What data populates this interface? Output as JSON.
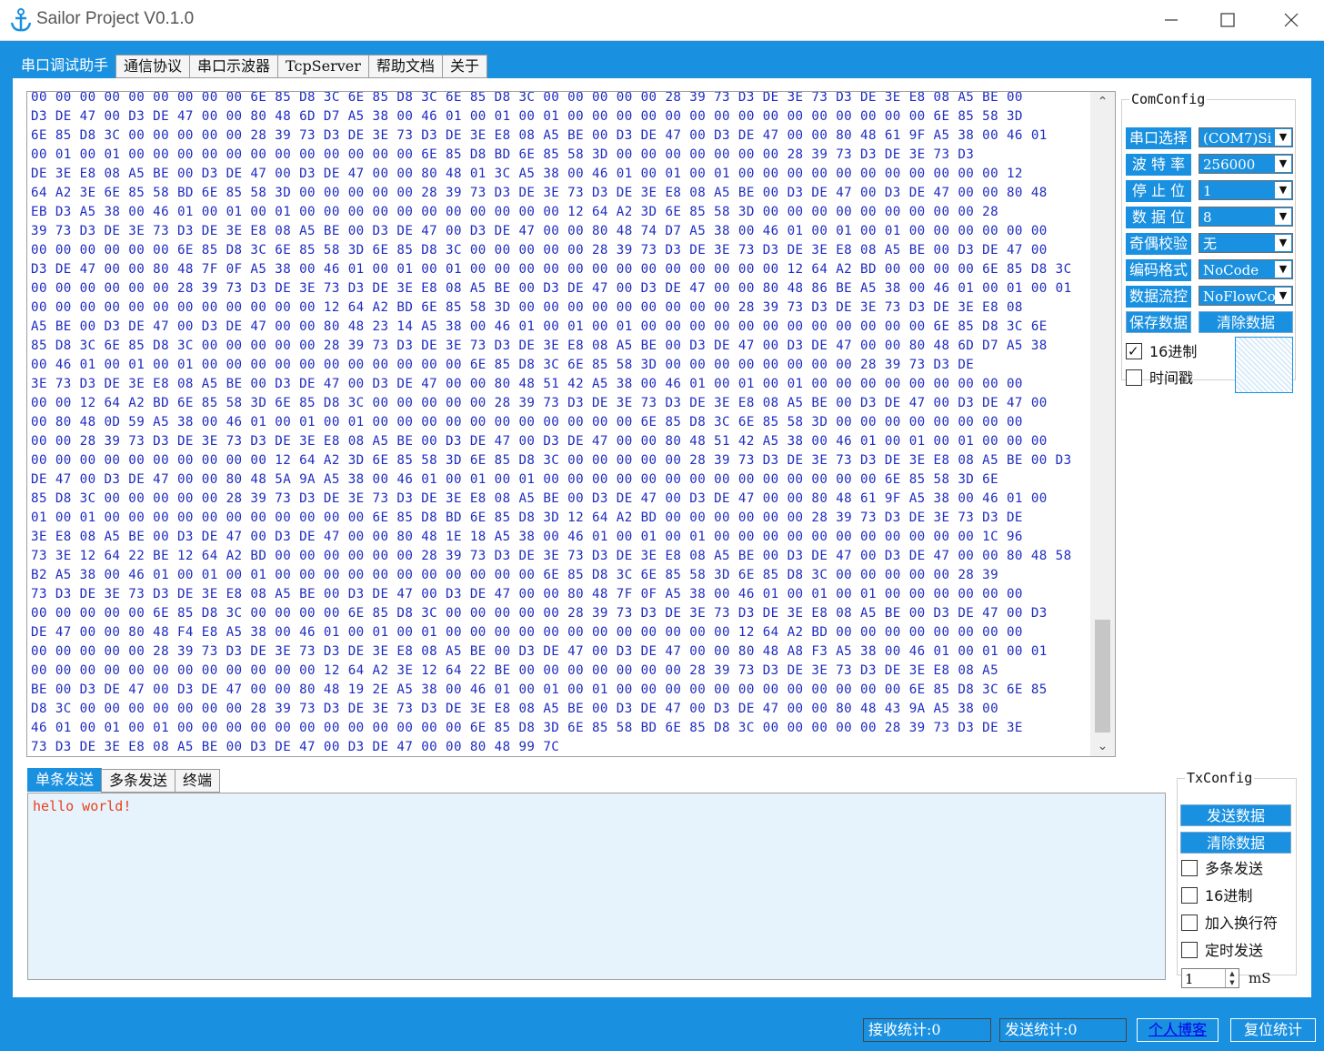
{
  "window": {
    "title": "Sailor Project V0.1.0",
    "accent_color": "#1a90e0",
    "icons": [
      "anchor-icon",
      "minimize-icon",
      "maximize-icon",
      "close-icon"
    ]
  },
  "tabs": [
    {
      "label": "串口调试助手",
      "active": true
    },
    {
      "label": "通信协议",
      "active": false
    },
    {
      "label": "串口示波器",
      "active": false
    },
    {
      "label": "TcpServer",
      "active": false
    },
    {
      "label": "帮助文档",
      "active": false
    },
    {
      "label": "关于",
      "active": false
    }
  ],
  "receive": {
    "lines": [
      "00 00 00 00 00 00 00 00 00 6E 85 D8 3C 6E 85 D8 3C 6E 85 D8 3C 00 00 00 00 00 28 39 73 D3 DE 3E 73 D3 DE 3E E8 08 A5 BE 00",
      "D3 DE 47 00 D3 DE 47 00 00 80 48 6D D7 A5 38 00 46 01 00 01 00 01 00 00 00 00 00 00 00 00 00 00 00 00 00 00 00 6E 85 58 3D",
      "6E 85 D8 3C 00 00 00 00 00 28 39 73 D3 DE 3E 73 D3 DE 3E E8 08 A5 BE 00 D3 DE 47 00 D3 DE 47 00 00 80 48 61 9F A5 38 00 46 01",
      "00 01 00 01 00 00 00 00 00 00 00 00 00 00 00 00 6E 85 D8 BD 6E 85 58 3D 00 00 00 00 00 00 00 28 39 73 D3 DE 3E 73 D3",
      "DE 3E E8 08 A5 BE 00 D3 DE 47 00 D3 DE 47 00 00 80 48 01 3C A5 38 00 46 01 00 01 00 01 00 00 00 00 00 00 00 00 00 00 00 12",
      "64 A2 3E 6E 85 58 BD 6E 85 58 3D 00 00 00 00 00 28 39 73 D3 DE 3E 73 D3 DE 3E E8 08 A5 BE 00 D3 DE 47 00 D3 DE 47 00 00 80 48",
      "EB D3 A5 38 00 46 01 00 01 00 01 00 00 00 00 00 00 00 00 00 00 00 12 64 A2 3D 6E 85 58 3D 00 00 00 00 00 00 00 00 00 28",
      "39 73 D3 DE 3E 73 D3 DE 3E E8 08 A5 BE 00 D3 DE 47 00 D3 DE 47 00 00 80 48 74 D7 A5 38 00 46 01 00 01 00 01 00 00 00 00 00 00",
      "00 00 00 00 00 00 6E 85 D8 3C 6E 85 58 3D 6E 85 D8 3C 00 00 00 00 00 28 39 73 D3 DE 3E 73 D3 DE 3E E8 08 A5 BE 00 D3 DE 47 00",
      "D3 DE 47 00 00 80 48 7F 0F A5 38 00 46 01 00 01 00 01 00 00 00 00 00 00 00 00 00 00 00 00 00 12 64 A2 BD 00 00 00 00 6E 85 D8 3C",
      "00 00 00 00 00 00 28 39 73 D3 DE 3E 73 D3 DE 3E E8 08 A5 BE 00 D3 DE 47 00 D3 DE 47 00 00 80 48 86 BE A5 38 00 46 01 00 01 00 01",
      "00 00 00 00 00 00 00 00 00 00 00 00 12 64 A2 BD 6E 85 58 3D 00 00 00 00 00 00 00 00 00 28 39 73 D3 DE 3E 73 D3 DE 3E E8 08",
      "A5 BE 00 D3 DE 47 00 D3 DE 47 00 00 80 48 23 14 A5 38 00 46 01 00 01 00 01 00 00 00 00 00 00 00 00 00 00 00 00 6E 85 D8 3C 6E",
      "85 D8 3C 6E 85 D8 3C 00 00 00 00 00 28 39 73 D3 DE 3E 73 D3 DE 3E E8 08 A5 BE 00 D3 DE 47 00 D3 DE 47 00 00 80 48 6D D7 A5 38",
      "00 46 01 00 01 00 01 00 00 00 00 00 00 00 00 00 00 00 6E 85 D8 3C 6E 85 58 3D 00 00 00 00 00 00 00 00 28 39 73 D3 DE",
      "3E 73 D3 DE 3E E8 08 A5 BE 00 D3 DE 47 00 D3 DE 47 00 00 80 48 51 42 A5 38 00 46 01 00 01 00 01 00 00 00 00 00 00 00 00 00",
      "00 00 12 64 A2 BD 6E 85 58 3D 6E 85 D8 3C 00 00 00 00 00 28 39 73 D3 DE 3E 73 D3 DE 3E E8 08 A5 BE 00 D3 DE 47 00 D3 DE 47 00",
      "00 80 48 0D 59 A5 38 00 46 01 00 01 00 01 00 00 00 00 00 00 00 00 00 00 00 6E 85 D8 3C 6E 85 58 3D 00 00 00 00 00 00 00 00",
      "00 00 28 39 73 D3 DE 3E 73 D3 DE 3E E8 08 A5 BE 00 D3 DE 47 00 D3 DE 47 00 00 80 48 51 42 A5 38 00 46 01 00 01 00 01 00 00 00",
      "00 00 00 00 00 00 00 00 00 00 12 64 A2 3D 6E 85 58 3D 6E 85 D8 3C 00 00 00 00 00 28 39 73 D3 DE 3E 73 D3 DE 3E E8 08 A5 BE 00 D3",
      "DE 47 00 D3 DE 47 00 00 80 48 5A 9A A5 38 00 46 01 00 01 00 01 00 00 00 00 00 00 00 00 00 00 00 00 00 00 6E 85 58 3D 6E",
      "85 D8 3C 00 00 00 00 00 28 39 73 D3 DE 3E 73 D3 DE 3E E8 08 A5 BE 00 D3 DE 47 00 D3 DE 47 00 00 80 48 61 9F A5 38 00 46 01 00",
      "01 00 01 00 00 00 00 00 00 00 00 00 00 00 6E 85 D8 BD 6E 85 D8 3D 12 64 A2 BD 00 00 00 00 00 00 28 39 73 D3 DE 3E 73 D3 DE",
      "3E E8 08 A5 BE 00 D3 DE 47 00 D3 DE 47 00 00 80 48 1E 18 A5 38 00 46 01 00 01 00 01 00 00 00 00 00 00 00 00 00 00 00 1C 96",
      "73 3E 12 64 22 BE 12 64 A2 BD 00 00 00 00 00 00 28 39 73 D3 DE 3E 73 D3 DE 3E E8 08 A5 BE 00 D3 DE 47 00 D3 DE 47 00 00 80 48 58",
      "B2 A5 38 00 46 01 00 01 00 01 00 00 00 00 00 00 00 00 00 00 00 6E 85 D8 3C 6E 85 58 3D 6E 85 D8 3C 00 00 00 00 00 28 39",
      "73 D3 DE 3E 73 D3 DE 3E E8 08 A5 BE 00 D3 DE 47 00 D3 DE 47 00 00 80 48 7F 0F A5 38 00 46 01 00 01 00 01 00 00 00 00 00 00",
      "00 00 00 00 00 6E 85 D8 3C 00 00 00 00 6E 85 D8 3C 00 00 00 00 00 28 39 73 D3 DE 3E 73 D3 DE 3E E8 08 A5 BE 00 D3 DE 47 00 D3",
      "DE 47 00 00 80 48 F4 E8 A5 38 00 46 01 00 01 00 01 00 00 00 00 00 00 00 00 00 00 00 00 12 64 A2 BD 00 00 00 00 00 00 00 00",
      "00 00 00 00 00 28 39 73 D3 DE 3E 73 D3 DE 3E E8 08 A5 BE 00 D3 DE 47 00 D3 DE 47 00 00 80 48 A8 F3 A5 38 00 46 01 00 01 00 01",
      "00 00 00 00 00 00 00 00 00 00 00 00 12 64 A2 3E 12 64 22 BE 00 00 00 00 00 00 00 28 39 73 D3 DE 3E 73 D3 DE 3E E8 08 A5",
      "BE 00 D3 DE 47 00 D3 DE 47 00 00 80 48 19 2E A5 38 00 46 01 00 01 00 01 00 00 00 00 00 00 00 00 00 00 00 00 6E 85 D8 3C 6E 85",
      "D8 3C 00 00 00 00 00 00 00 28 39 73 D3 DE 3E 73 D3 DE 3E E8 08 A5 BE 00 D3 DE 47 00 D3 DE 47 00 00 80 48 43 9A A5 38 00",
      "46 01 00 01 00 01 00 00 00 00 00 00 00 00 00 00 00 00 6E 85 D8 3D 6E 85 58 BD 6E 85 D8 3C 00 00 00 00 00 28 39 73 D3 DE 3E",
      "73 D3 DE 3E E8 08 A5 BE 00 D3 DE 47 00 D3 DE 47 00 00 80 48 99 7C"
    ]
  },
  "com_config": {
    "legend": "ComConfig",
    "rows": [
      {
        "label": "串口选择",
        "value": "(COM7)Si"
      },
      {
        "label": "波 特 率",
        "value": "256000"
      },
      {
        "label": "停 止 位",
        "value": "1"
      },
      {
        "label": "数 据 位",
        "value": "8"
      },
      {
        "label": "奇偶校验",
        "value": "无"
      },
      {
        "label": "编码格式",
        "value": "NoCode"
      },
      {
        "label": "数据流控",
        "value": "NoFlowCo"
      }
    ],
    "save_check_label": "保存数据",
    "clear_data_label": "清除数据",
    "hex_label": "16进制",
    "hex_checked": true,
    "time_label": "时间戳",
    "time_checked": false
  },
  "send": {
    "subtabs": [
      {
        "label": "单条发送",
        "active": true
      },
      {
        "label": "多条发送",
        "active": false
      },
      {
        "label": "终端",
        "active": false
      }
    ],
    "text": "hello world!"
  },
  "tx_config": {
    "legend": "TxConfig",
    "send_label": "发送数据",
    "clear_label": "清除数据",
    "options": [
      {
        "label": "多条发送",
        "checked": false
      },
      {
        "label": "16进制",
        "checked": false
      },
      {
        "label": "加入换行符",
        "checked": false
      },
      {
        "label": "定时发送",
        "checked": false
      }
    ],
    "interval_value": "1",
    "interval_unit": "mS"
  },
  "status": {
    "rx_label": "接收统计:0",
    "tx_label": "发送统计:0",
    "blog_label": "个人博客",
    "reset_label": "复位统计"
  }
}
